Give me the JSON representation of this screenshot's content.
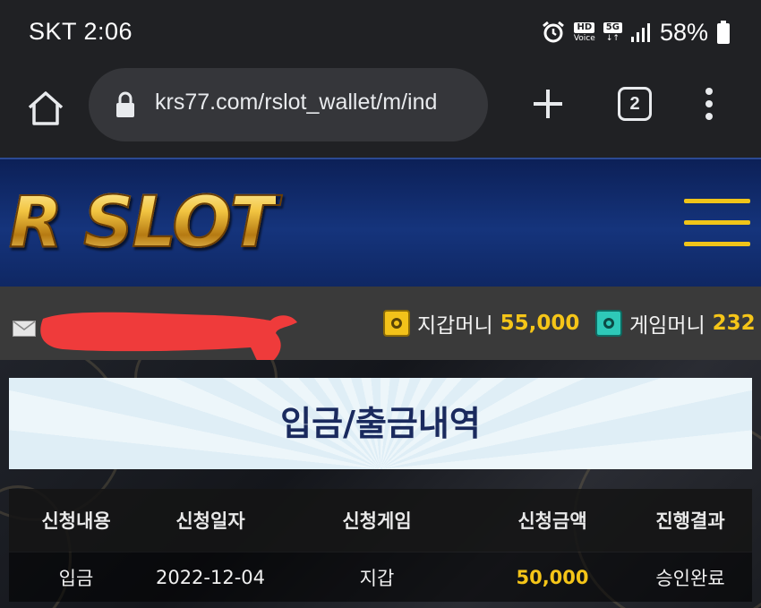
{
  "status_bar": {
    "carrier_time": "SKT 2:06",
    "hd_badge": "HD",
    "hd_sub": "Voice",
    "network": "5G",
    "battery": "58%"
  },
  "browser": {
    "url": "krs77.com/rslot_wallet/m/ind",
    "tab_count": "2"
  },
  "site": {
    "logo_text": "R SLOT",
    "accent_color": "#f5c518"
  },
  "user_bar": {
    "wallet_label": "지갑머니",
    "wallet_value": "55,000",
    "game_label": "게임머니",
    "game_value": "232"
  },
  "page": {
    "title": "입금/출금내역"
  },
  "history_table": {
    "headers": [
      "신청내용",
      "신청일자",
      "신청게임",
      "신청금액",
      "진행결과"
    ],
    "rows": [
      [
        "입금",
        "2022-12-04",
        "지갑",
        "50,000",
        "승인완료"
      ]
    ]
  }
}
